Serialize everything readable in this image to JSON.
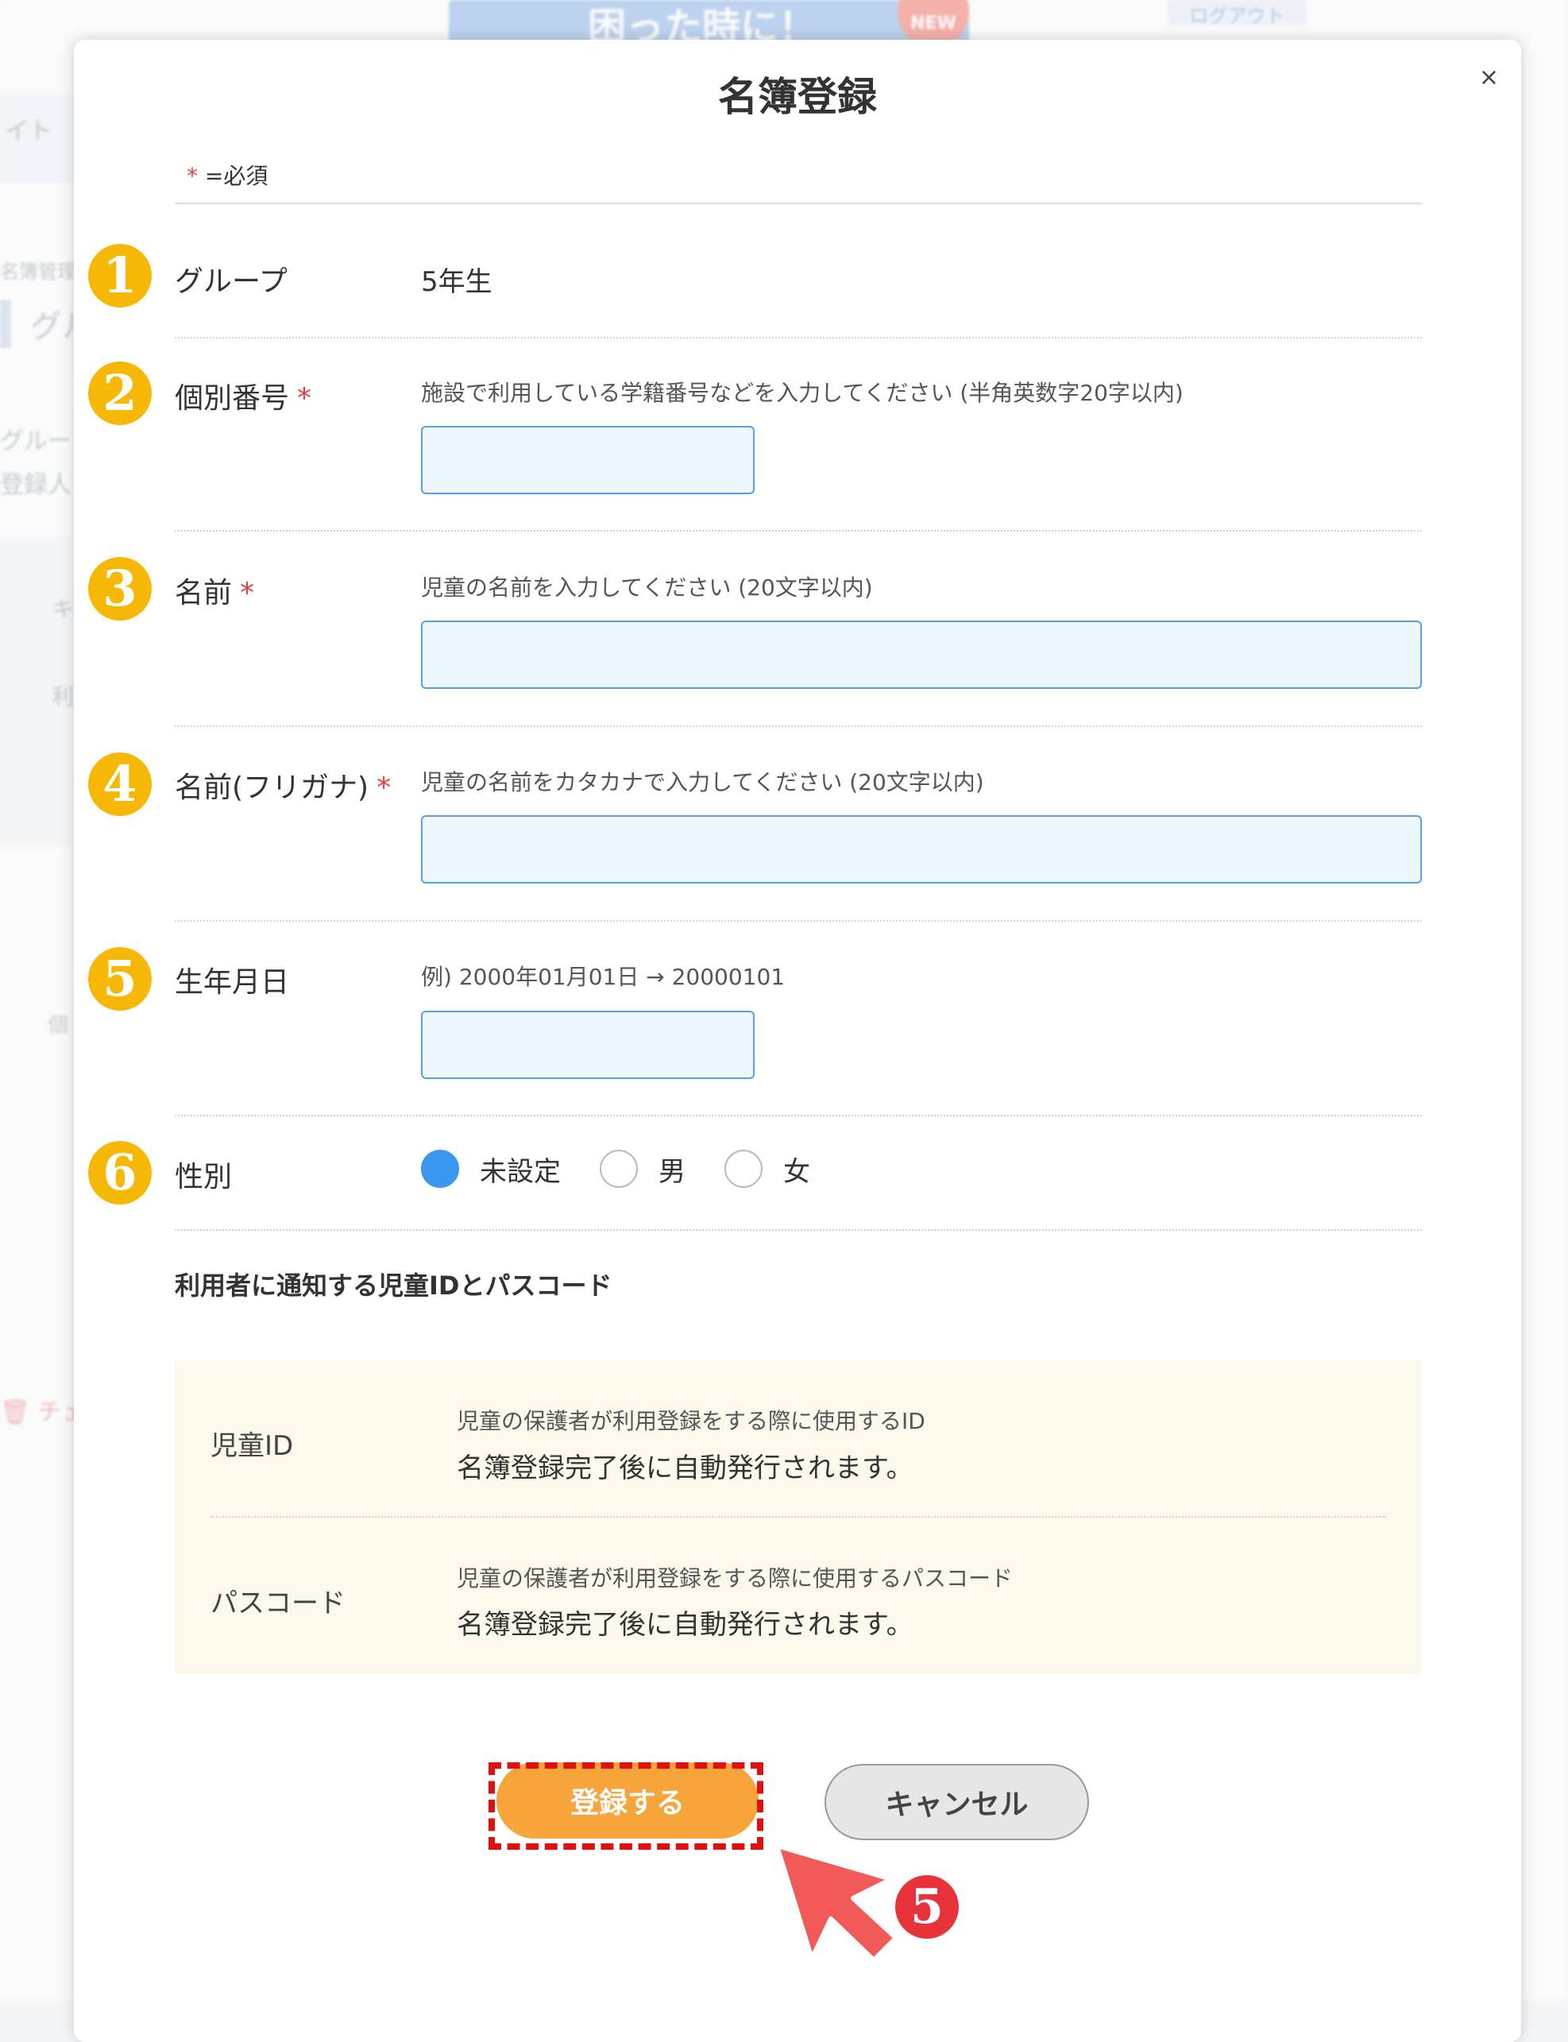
{
  "background": {
    "banner_text": "困った時に！",
    "new_badge": "NEW",
    "logout_label": "ログアウト",
    "nav_text": "イト",
    "side_texts": [
      "名簿管理",
      "グル",
      "グルー",
      "登録人"
    ],
    "panel_texts": [
      "キ",
      "利",
      "個"
    ],
    "trash_text": "チェ"
  },
  "modal": {
    "title": "名簿登録",
    "close": "×",
    "required_note_mark": "*",
    "required_note_text": "=必須",
    "fields": {
      "group": {
        "num": "1",
        "label": "グループ",
        "value": "5年生"
      },
      "student_no": {
        "num": "2",
        "label": "個別番号",
        "required_mark": "*",
        "help": "施設で利用している学籍番号などを入力してください (半角英数字20字以内)",
        "value": ""
      },
      "name": {
        "num": "3",
        "label": "名前",
        "required_mark": "*",
        "help": "児童の名前を入力してください (20文字以内)",
        "value": ""
      },
      "kana": {
        "num": "4",
        "label": "名前(フリガナ)",
        "required_mark": "*",
        "help": "児童の名前をカタカナで入力してください (20文字以内)",
        "value": ""
      },
      "birthday": {
        "num": "5",
        "label": "生年月日",
        "help": "例) 2000年01月01日 → 20000101",
        "value": ""
      },
      "gender": {
        "num": "6",
        "label": "性別",
        "options": [
          "未設定",
          "男",
          "女"
        ],
        "selected": "未設定"
      }
    },
    "notice_heading": "利用者に通知する児童IDとパスコード",
    "info": [
      {
        "label": "児童ID",
        "desc": "児童の保護者が利用登録をする際に使用するID",
        "value": "名簿登録完了後に自動発行されます。"
      },
      {
        "label": "パスコード",
        "desc": "児童の保護者が利用登録をする際に使用するパスコード",
        "value": "名簿登録完了後に自動発行されます。"
      }
    ],
    "register_label": "登録する",
    "cancel_label": "キャンセル"
  },
  "annotation": {
    "step_number": "5"
  },
  "colors": {
    "accent_orange": "#f7a43a",
    "badge_yellow": "#f6b705",
    "required_red": "#e24141",
    "input_border": "#5a9fe0",
    "radio_blue": "#3a97f0",
    "highlight_red": "#e01010",
    "pointer_red": "#f25a5a"
  }
}
